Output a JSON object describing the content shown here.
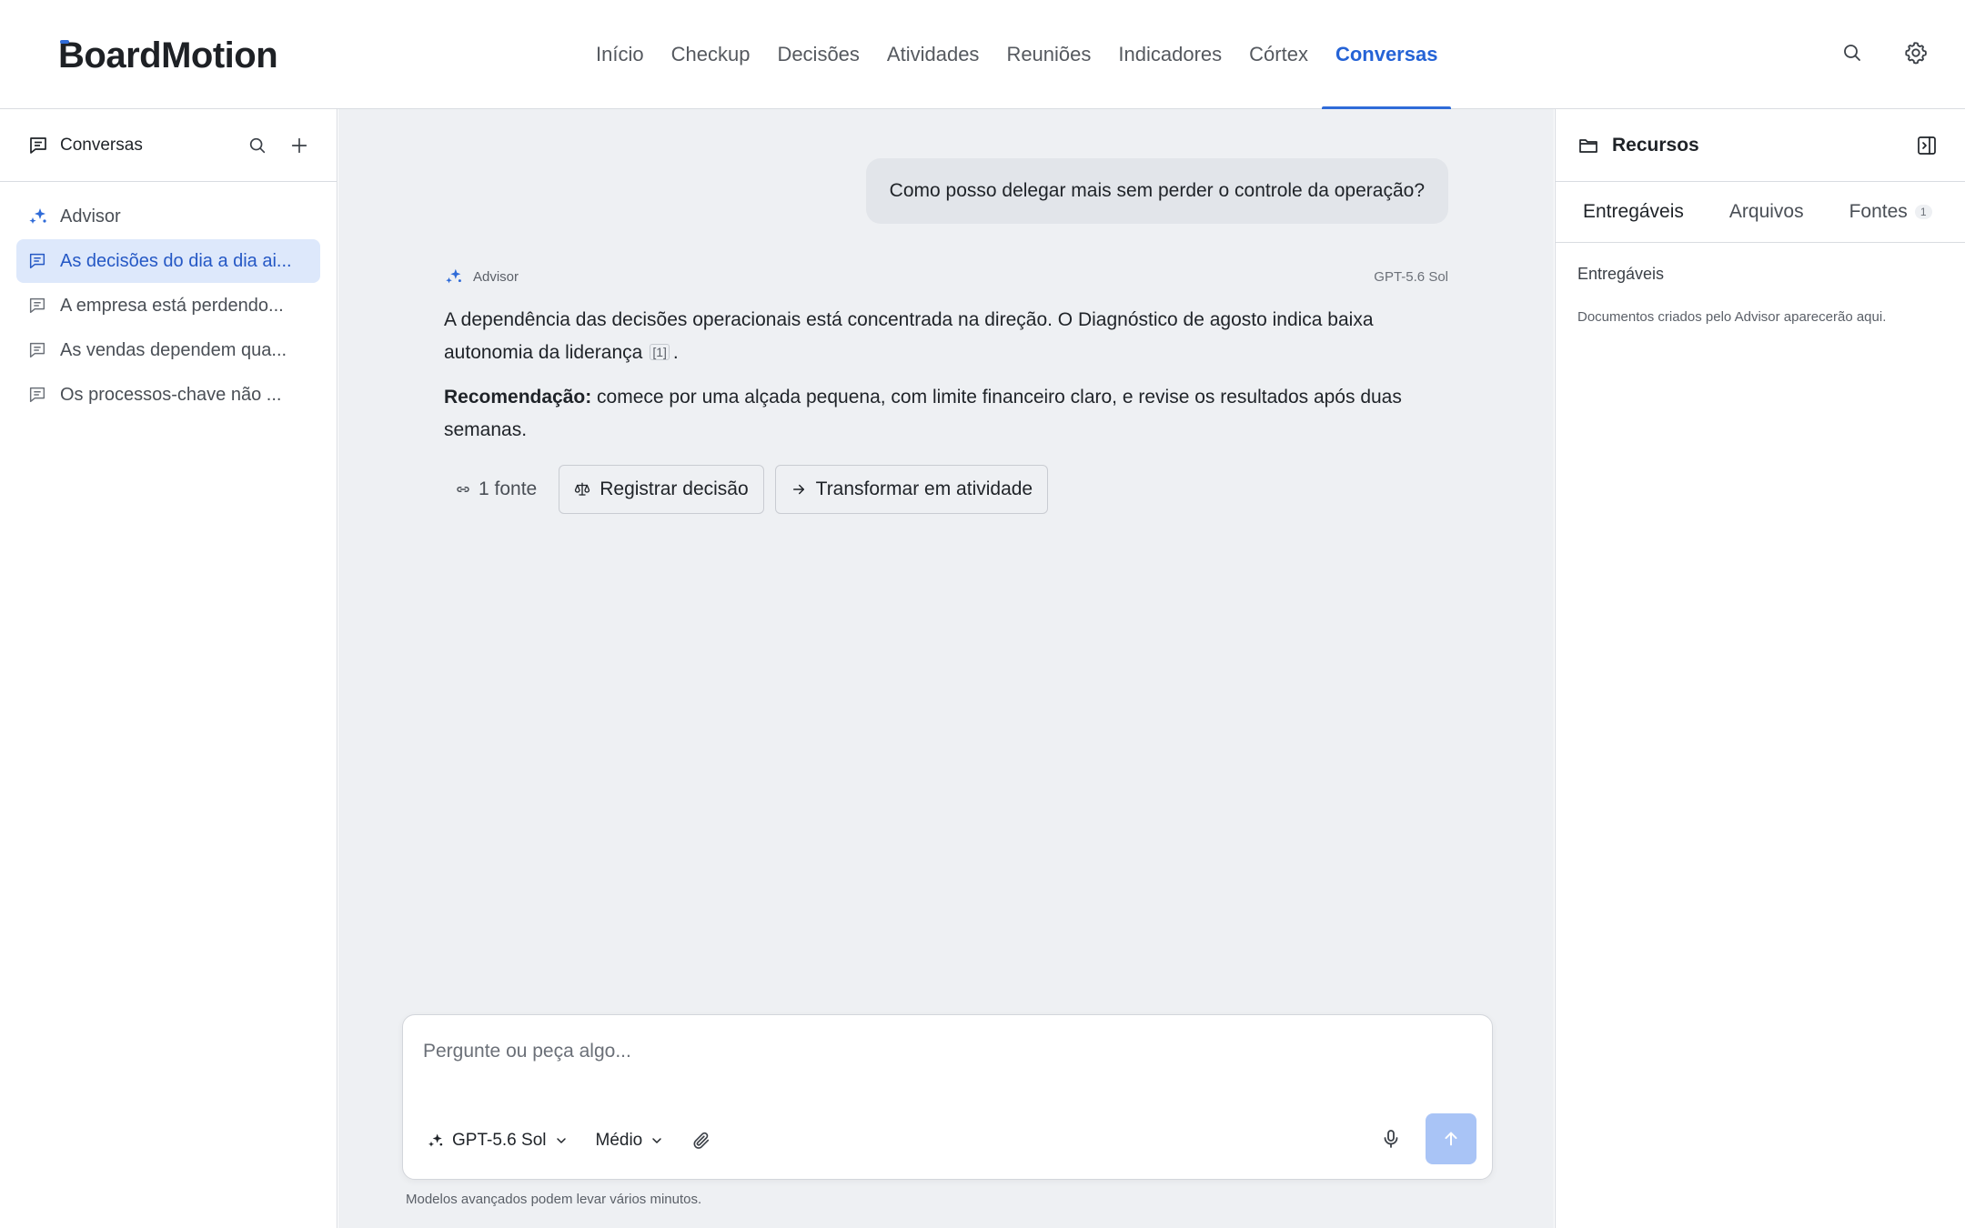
{
  "brand": {
    "logo_text": "BoardMotion"
  },
  "nav": {
    "items": [
      {
        "label": "Início"
      },
      {
        "label": "Checkup"
      },
      {
        "label": "Decisões"
      },
      {
        "label": "Atividades"
      },
      {
        "label": "Reuniões"
      },
      {
        "label": "Indicadores"
      },
      {
        "label": "Córtex"
      },
      {
        "label": "Conversas",
        "active": true
      }
    ]
  },
  "header_icons": [
    "search-icon",
    "gear-icon"
  ],
  "sidebar": {
    "title": "Conversas",
    "items": [
      {
        "label": "Advisor",
        "icon": "sparkle-icon"
      },
      {
        "label": "As decisões do dia a dia ai...",
        "icon": "chat-icon",
        "active": true
      },
      {
        "label": "A empresa está perdendo...",
        "icon": "chat-icon"
      },
      {
        "label": "As vendas dependem qua...",
        "icon": "chat-icon"
      },
      {
        "label": "Os processos-chave não ...",
        "icon": "chat-icon"
      }
    ]
  },
  "chat": {
    "user_message": "Como posso delegar mais sem perder o controle da operação?",
    "assistant": {
      "name": "Advisor",
      "model": "GPT-5.6 Sol",
      "paragraph1": "A dependência das decisões operacionais está concentrada na direção. O Diagnóstico de agosto indica baixa autonomia da liderança",
      "citation": "[1]",
      "paragraph1_end": ".",
      "rec_label": "Recomendação:",
      "rec_text": " comece por uma alçada pequena, com limite financeiro claro, e revise os resultados após duas semanas.",
      "sources_label": "1 fonte",
      "actions": [
        {
          "label": "Registrar decisão",
          "icon": "scale-icon"
        },
        {
          "label": "Transformar em atividade",
          "icon": "arrow-right-icon"
        }
      ]
    }
  },
  "composer": {
    "placeholder": "Pergunte ou peça algo...",
    "model": "GPT-5.6 Sol",
    "effort": "Médio",
    "footnote": "Modelos avançados podem levar vários minutos."
  },
  "resources": {
    "title": "Recursos",
    "tabs": [
      {
        "label": "Entregáveis",
        "active": true
      },
      {
        "label": "Arquivos"
      },
      {
        "label": "Fontes",
        "badge": "1"
      }
    ],
    "section_title": "Entregáveis",
    "empty_text": "Documentos criados pelo Advisor aparecerão aqui."
  },
  "colors": {
    "accent": "#2f6bd8",
    "active_bg": "#dde8fb",
    "main_bg": "#eef0f3",
    "send_btn": "#a9c4f6"
  }
}
